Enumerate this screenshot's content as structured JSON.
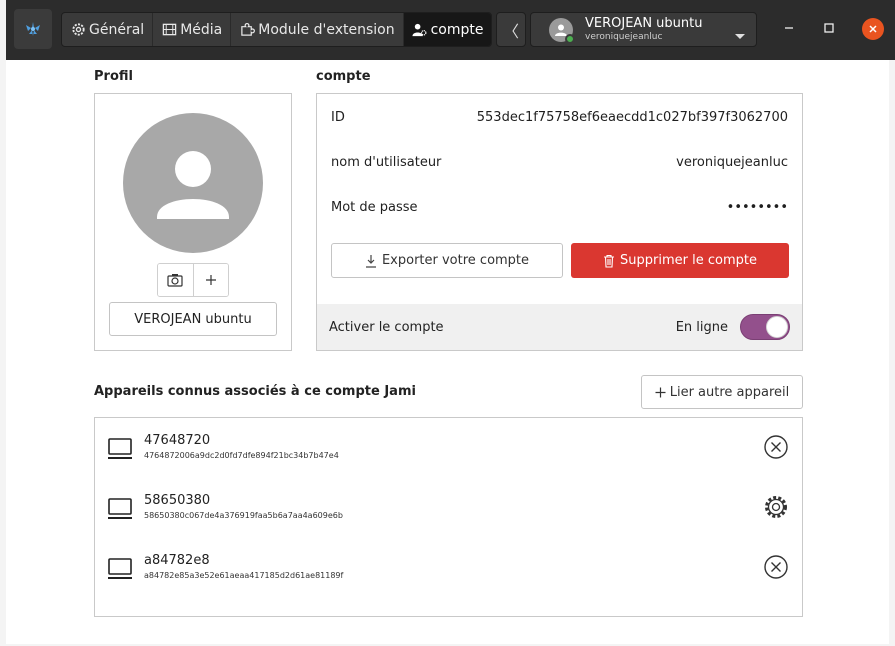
{
  "titlebar": {
    "tabs": [
      {
        "label": "Général",
        "icon": "gear-icon"
      },
      {
        "label": "Média",
        "icon": "film-icon"
      },
      {
        "label": "Module d'extension",
        "icon": "puzzle-icon"
      },
      {
        "label": "compte",
        "icon": "user-gear-icon"
      }
    ],
    "active_tab": "compte",
    "account": {
      "name": "VEROJEAN ubuntu",
      "username": "veroniquejeanluc",
      "status_color": "#4caf50"
    },
    "close_color": "#e95420"
  },
  "profile": {
    "title": "Profil",
    "alias": "VEROJEAN ubuntu"
  },
  "account": {
    "title": "compte",
    "fields": [
      {
        "label": "ID",
        "value": "553dec1f75758ef6eaecdd1c027bf397f3062700"
      },
      {
        "label": "nom d'utilisateur",
        "value": "veroniquejeanluc"
      },
      {
        "label": "Mot de passe",
        "value": "••••••••"
      }
    ],
    "export_label": "Exporter votre compte",
    "delete_label": "Supprimer le compte",
    "delete_color": "#da3730",
    "activate_label": "Activer le compte",
    "status_label": "En ligne",
    "toggle_on": true,
    "toggle_color": "#93508c"
  },
  "devices": {
    "title": "Appareils connus associés à ce compte Jami",
    "link_label": "Lier autre appareil",
    "items": [
      {
        "name": "47648720",
        "id": "4764872006a9dc2d0fd7dfe894f21bc34b7b47e4",
        "action_icon": "remove-circle-icon"
      },
      {
        "name": "58650380",
        "id": "58650380c067de4a376919faa5b6a7aa4a609e6b",
        "action_icon": "gear-icon"
      },
      {
        "name": "a84782e8",
        "id": "a84782e85a3e52e61aeaa417185d2d61ae81189f",
        "action_icon": "remove-circle-icon"
      }
    ]
  }
}
